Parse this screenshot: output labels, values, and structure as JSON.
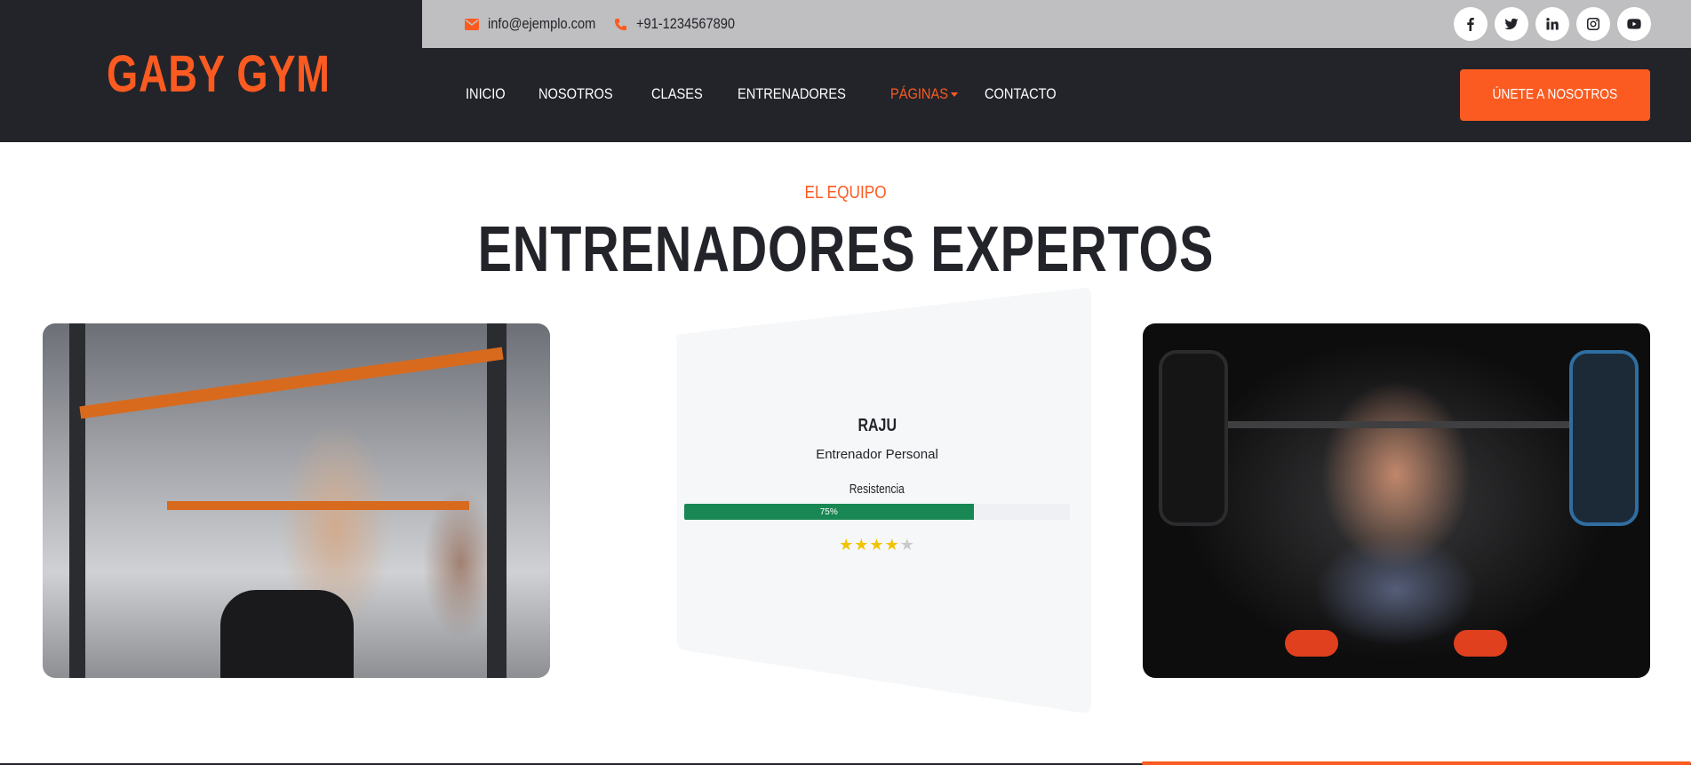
{
  "brand": {
    "name": "GABY GYM"
  },
  "topbar": {
    "email": "info@ejemplo.com",
    "phone": "+91-1234567890",
    "socials": [
      "facebook-icon",
      "twitter-icon",
      "linkedin-icon",
      "instagram-icon",
      "youtube-icon"
    ]
  },
  "nav": {
    "items": [
      {
        "label": "INICIO"
      },
      {
        "label": "NOSOTROS"
      },
      {
        "label": "CLASES"
      },
      {
        "label": "ENTRENADORES"
      },
      {
        "label": "PÁGINAS"
      },
      {
        "label": "CONTACTO"
      }
    ],
    "active": "PÁGINAS"
  },
  "cta": {
    "label": "ÚNETE A NOSOTROS"
  },
  "section": {
    "subtitle": "EL EQUIPO",
    "title": "ENTRENADORES EXPERTOS"
  },
  "trainer": {
    "name": "RAJU",
    "role": "Entrenador Personal",
    "skill_label": "Resistencia",
    "skill_percent": 75,
    "skill_text": "75%",
    "rating": 4,
    "rating_max": 5
  },
  "colors": {
    "accent": "#fb5b21",
    "dark": "#23242a",
    "topbar": "#bfbfc1",
    "progress": "#198754",
    "star": "#f0c400"
  }
}
